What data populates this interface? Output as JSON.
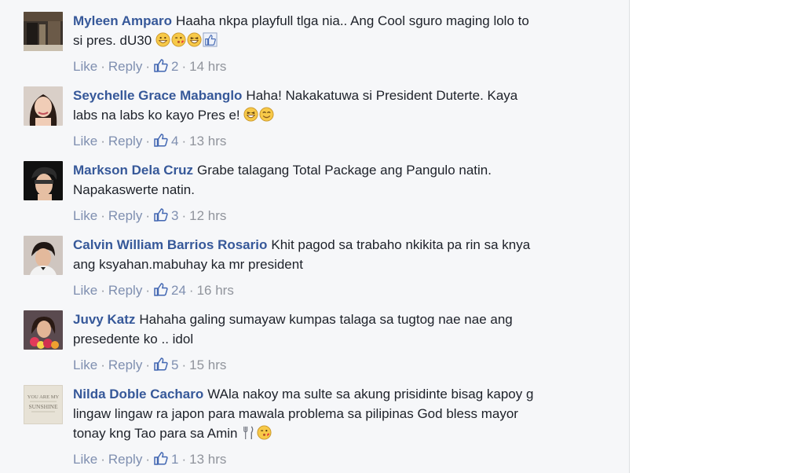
{
  "comments": [
    {
      "author": "Myleen Amparo",
      "lines": [
        "Haaha nkpa playfull tlga nia.. Ang Cool sguro maging lolo to",
        "si pres. dU30"
      ],
      "emojis": [
        "grin-emoji",
        "kiss-wink-emoji",
        "laugh-emoji",
        "like-emoji"
      ],
      "like_label": "Like",
      "reply_label": "Reply",
      "separator": "·",
      "likes": "2",
      "time": "14 hrs"
    },
    {
      "author": "Seychelle Grace Mabanglo",
      "lines": [
        "Haha! Nakakatuwa si President Duterte. Kaya",
        "labs na labs ko kayo Pres e!"
      ],
      "emojis": [
        "laugh-emoji",
        "smile-emoji"
      ],
      "like_label": "Like",
      "reply_label": "Reply",
      "separator": "·",
      "likes": "4",
      "time": "13 hrs"
    },
    {
      "author": "Markson Dela Cruz",
      "lines": [
        "Grabe talagang Total Package ang Pangulo natin.",
        "Napakaswerte natin."
      ],
      "emojis": [],
      "like_label": "Like",
      "reply_label": "Reply",
      "separator": "·",
      "likes": "3",
      "time": "12 hrs"
    },
    {
      "author": "Calvin William Barrios Rosario",
      "lines": [
        "Khit pagod sa trabaho nkikita pa rin sa knya",
        "ang ksyahan.mabuhay ka mr president"
      ],
      "emojis": [],
      "like_label": "Like",
      "reply_label": "Reply",
      "separator": "·",
      "likes": "24",
      "time": "16 hrs"
    },
    {
      "author": "Juvy Katz",
      "lines": [
        "Hahaha galing sumayaw kumpas talaga sa tugtog nae nae ang",
        "presedente ko .. idol"
      ],
      "emojis": [],
      "like_label": "Like",
      "reply_label": "Reply",
      "separator": "·",
      "likes": "5",
      "time": "15 hrs"
    },
    {
      "author": "Nilda Doble Cacharo",
      "lines": [
        "WAla nakoy ma sulte sa akung prisidinte bisag kapoy g",
        "lingaw lingaw ra japon para mawala problema sa pilipinas God bless mayor",
        "tonay kng Tao para sa Amin"
      ],
      "emojis": [
        "fork-knife-emoji",
        "kiss-wink-emoji"
      ],
      "avatar_text": [
        "YOU ARE MY",
        "SUNSHINE"
      ],
      "like_label": "Like",
      "reply_label": "Reply",
      "separator": "·",
      "likes": "1",
      "time": "13 hrs"
    }
  ]
}
